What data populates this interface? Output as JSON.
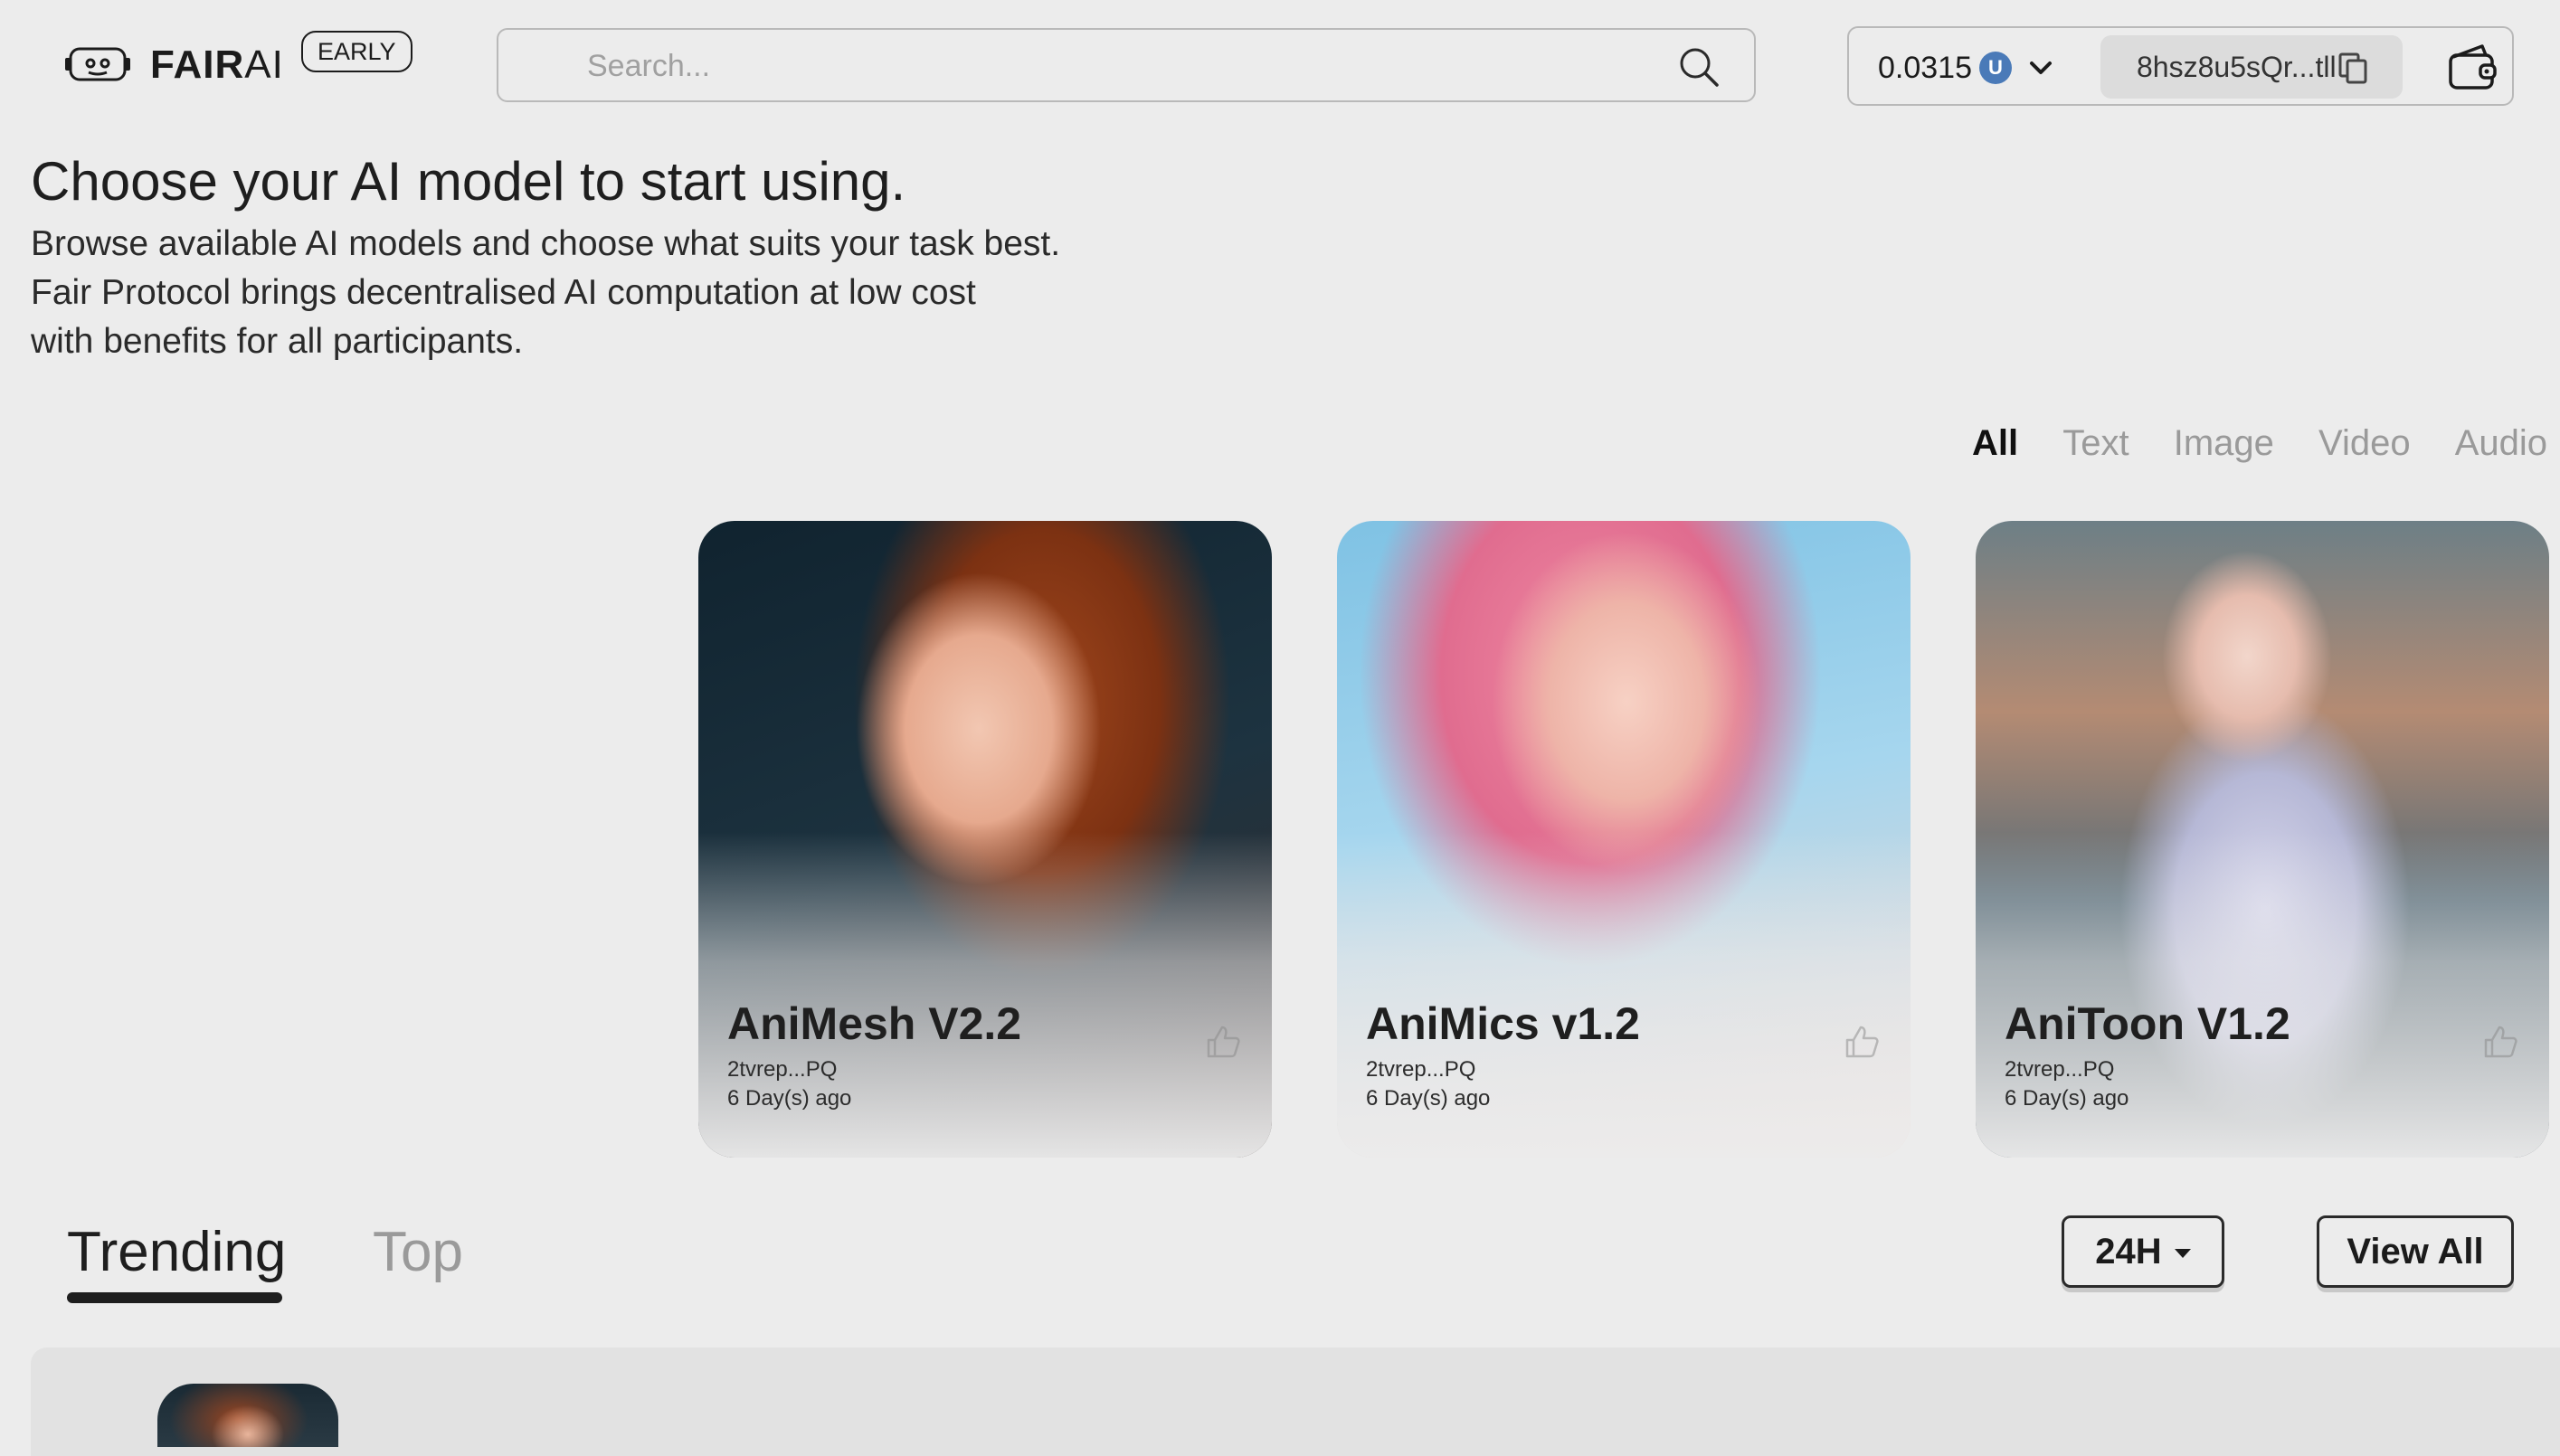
{
  "header": {
    "brand_bold": "FAIR",
    "brand_light": "AI",
    "badge": "EARLY",
    "search_placeholder": "Search...",
    "balance": "0.0315",
    "token_symbol": "U",
    "wallet_address": "8hsz8u5sQr...tll"
  },
  "hero": {
    "title": "Choose your AI model to start using.",
    "line1": "Browse available AI models and choose what suits your task best.",
    "line2": "Fair Protocol brings decentralised AI computation at low cost",
    "line3": "with benefits for all participants."
  },
  "filters": [
    "All",
    "Text",
    "Image",
    "Video",
    "Audio"
  ],
  "active_filter": "All",
  "cards": [
    {
      "title": "AniMesh V2.2",
      "owner": "2tvrep...PQ",
      "time": "6 Day(s) ago"
    },
    {
      "title": "AniMics v1.2",
      "owner": "2tvrep...PQ",
      "time": "6 Day(s) ago"
    },
    {
      "title": "AniToon V1.2",
      "owner": "2tvrep...PQ",
      "time": "6 Day(s) ago"
    }
  ],
  "tabs": {
    "trending": "Trending",
    "top": "Top",
    "active": "Trending"
  },
  "controls": {
    "period": "24H",
    "view_all": "View All"
  },
  "icons": {
    "logo": "robot-face-icon",
    "search": "search-icon",
    "token": "token-icon",
    "dropdown": "chevron-down-icon",
    "copy": "copy-icon",
    "wallet": "wallet-icon",
    "like": "thumbs-up-icon"
  },
  "colors": {
    "background": "#ececec",
    "text": "#1b1b1b",
    "muted": "#9a9a9a",
    "token_blue": "#4a7ab8"
  }
}
